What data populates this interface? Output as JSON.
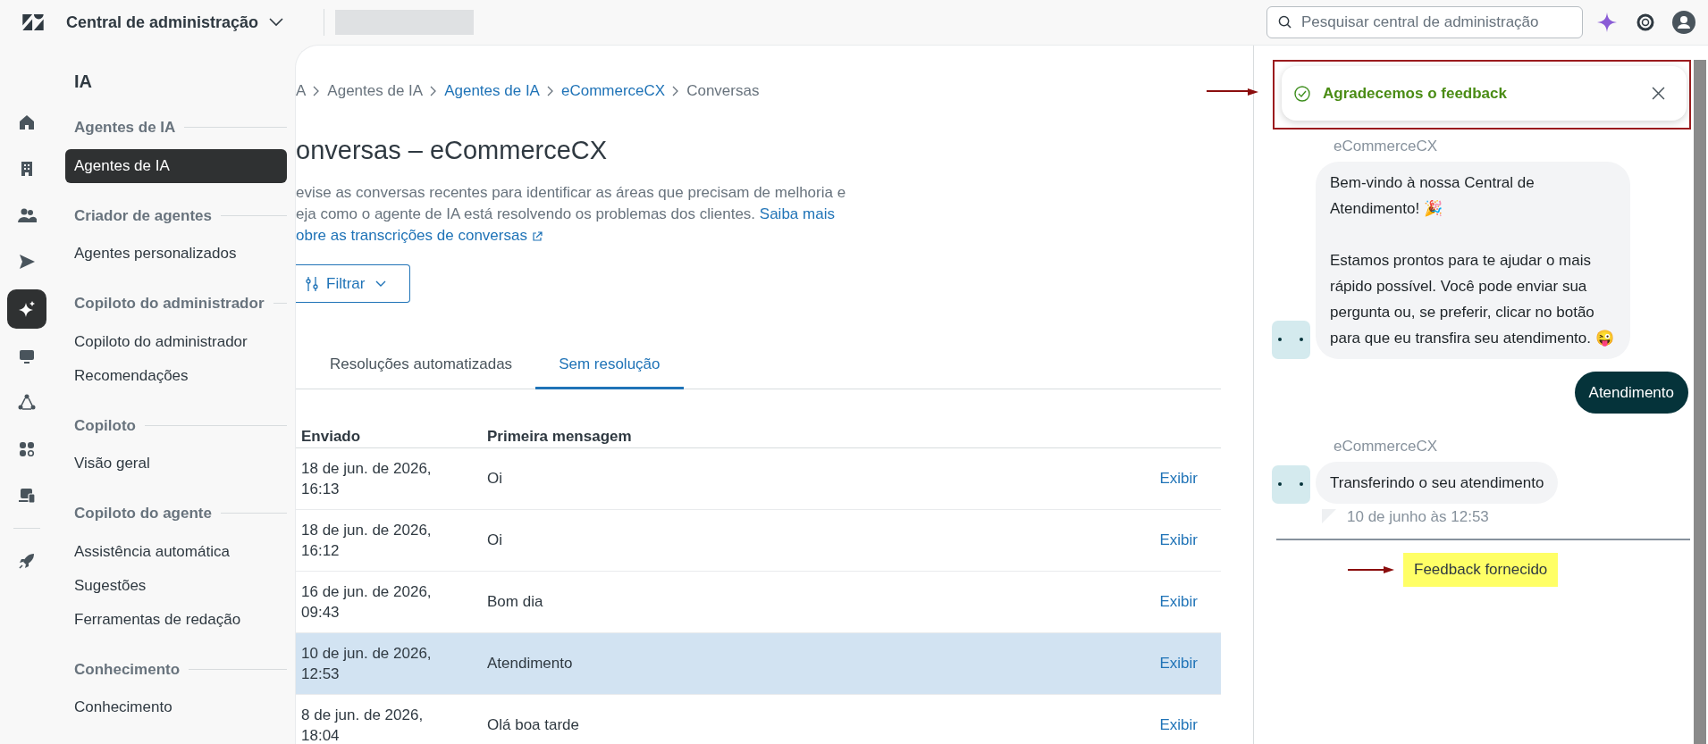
{
  "header": {
    "title": "Central de administração",
    "search": {
      "placeholder": "Pesquisar central de administração"
    }
  },
  "rail": [
    {
      "selected": false
    },
    {
      "selected": false
    },
    {
      "selected": false
    },
    {
      "selected": false
    },
    {
      "selected": true
    },
    {
      "selected": false
    },
    {
      "selected": false
    },
    {
      "selected": false
    },
    {
      "selected": false
    },
    {
      "selected": false
    }
  ],
  "nav": {
    "title": "IA",
    "sections": [
      {
        "heading": "Agentes de IA",
        "items": [
          {
            "label": "Agentes de IA",
            "selected": true
          }
        ]
      },
      {
        "heading": "Criador de agentes",
        "items": [
          {
            "label": "Agentes personalizados",
            "selected": false
          }
        ]
      },
      {
        "heading": "Copiloto do administrador",
        "items": [
          {
            "label": "Copiloto do administrador",
            "selected": false
          },
          {
            "label": "Recomendações",
            "selected": false
          }
        ]
      },
      {
        "heading": "Copiloto",
        "items": [
          {
            "label": "Visão geral",
            "selected": false
          }
        ]
      },
      {
        "heading": "Copiloto do agente",
        "items": [
          {
            "label": "Assistência automática",
            "selected": false
          },
          {
            "label": "Sugestões",
            "selected": false
          },
          {
            "label": "Ferramentas de redação",
            "selected": false
          }
        ]
      },
      {
        "heading": "Conhecimento",
        "items": [
          {
            "label": "Conhecimento",
            "selected": false
          }
        ]
      }
    ]
  },
  "breadcrumb": [
    {
      "label": "A",
      "link": false
    },
    {
      "label": "Agentes de IA",
      "link": false
    },
    {
      "label": "Agentes de IA",
      "link": true
    },
    {
      "label": "eCommerceCX",
      "link": true
    },
    {
      "label": "Conversas",
      "link": false
    }
  ],
  "page": {
    "title": "onversas – eCommerceCX",
    "description": "evise as conversas recentes para identificar as áreas que precisam de melhoria e eja como o agente de IA está resolvendo os problemas dos clientes.",
    "link": [
      "Saiba mais",
      "obre as transcrições de conversas"
    ],
    "filter": "Filtrar"
  },
  "tabs": [
    {
      "label": "Resoluções automatizadas",
      "selected": false
    },
    {
      "label": "Sem resolução",
      "selected": true
    }
  ],
  "table": {
    "columns": [
      "Enviado",
      "Primeira mensagem"
    ],
    "rows": [
      {
        "sent": "18 de jun. de 2026, 16:13",
        "message": "Oi",
        "action": "Exibir",
        "selected": false
      },
      {
        "sent": "18 de jun. de 2026, 16:12",
        "message": "Oi",
        "action": "Exibir",
        "selected": false
      },
      {
        "sent": "16 de jun. de 2026, 09:43",
        "message": "Bom dia",
        "action": "Exibir",
        "selected": false
      },
      {
        "sent": "10 de jun. de 2026, 12:53",
        "message": "Atendimento",
        "action": "Exibir",
        "selected": true
      },
      {
        "sent": "8 de jun. de 2026, 18:04",
        "message": "Olá boa tarde",
        "action": "Exibir",
        "selected": false
      }
    ]
  },
  "toast": {
    "message": "Agradecemos o feedback"
  },
  "chat": {
    "messages": [
      {
        "kind": "bot",
        "sender": "eCommerceCX",
        "text": "Bem-vindo à nossa Central de Atendimento! 🎉\n\nEstamos prontos para te ajudar o mais rápido possível. Você pode enviar sua pergunta ou, se preferir, clicar no botão para que eu transfira seu atendimento. 😜"
      },
      {
        "kind": "user",
        "text": "Atendimento"
      },
      {
        "kind": "bot",
        "sender": "eCommerceCX",
        "text": "Transferindo o seu atendimento",
        "time": "10 de junho às 12:53"
      }
    ],
    "feedback_status": "Feedback fornecido"
  }
}
